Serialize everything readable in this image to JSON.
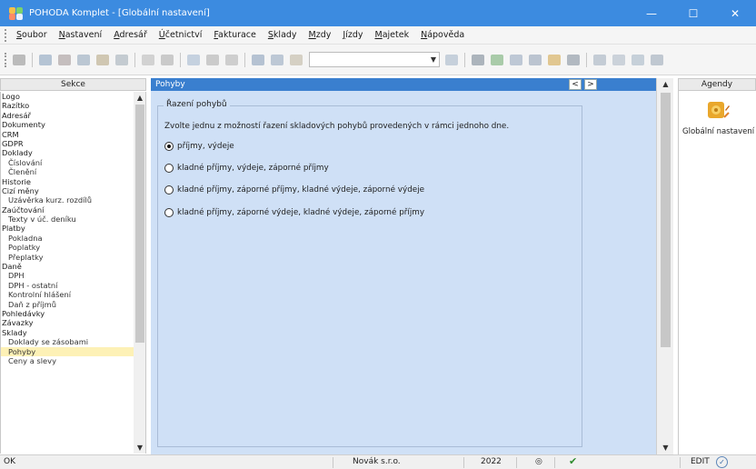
{
  "window": {
    "title": "POHODA Komplet - [Globální nastavení]",
    "minimize_glyph": "—",
    "maximize_glyph": "☐",
    "close_glyph": "✕"
  },
  "menu": {
    "items": [
      {
        "label": "Soubor",
        "key": "S",
        "rest": "oubor"
      },
      {
        "label": "Nastavení",
        "key": "N",
        "rest": "astavení"
      },
      {
        "label": "Adresář",
        "key": "A",
        "rest": "dresář"
      },
      {
        "label": "Účetnictví",
        "key": "Ú",
        "rest": "četnictví"
      },
      {
        "label": "Fakturace",
        "key": "F",
        "rest": "akturace"
      },
      {
        "label": "Sklady",
        "key": "S",
        "rest": "klady"
      },
      {
        "label": "Mzdy",
        "key": "M",
        "rest": "zdy"
      },
      {
        "label": "Jízdy",
        "key": "J",
        "rest": "ízdy"
      },
      {
        "label": "Majetek",
        "key": "M",
        "rest": "ajetek"
      },
      {
        "label": "Nápověda",
        "key": "N",
        "rest": "ápověda"
      }
    ]
  },
  "sekce": {
    "header": "Sekce",
    "items": [
      {
        "label": "Logo",
        "sub": false
      },
      {
        "label": "Razítko",
        "sub": false
      },
      {
        "label": "Adresář",
        "sub": false
      },
      {
        "label": "Dokumenty",
        "sub": false
      },
      {
        "label": "CRM",
        "sub": false
      },
      {
        "label": "GDPR",
        "sub": false
      },
      {
        "label": "Doklady",
        "sub": false
      },
      {
        "label": "Číslování",
        "sub": true
      },
      {
        "label": "Členění",
        "sub": true
      },
      {
        "label": "Historie",
        "sub": false
      },
      {
        "label": "Cizí měny",
        "sub": false
      },
      {
        "label": "Uzávěrka kurz. rozdílů",
        "sub": true
      },
      {
        "label": "Zaúčtování",
        "sub": false
      },
      {
        "label": "Texty v úč. deníku",
        "sub": true
      },
      {
        "label": "Platby",
        "sub": false
      },
      {
        "label": "Pokladna",
        "sub": true
      },
      {
        "label": "Poplatky",
        "sub": true
      },
      {
        "label": "Přeplatky",
        "sub": true
      },
      {
        "label": "Daně",
        "sub": false
      },
      {
        "label": "DPH",
        "sub": true
      },
      {
        "label": "DPH - ostatní",
        "sub": true
      },
      {
        "label": "Kontrolní hlášení",
        "sub": true
      },
      {
        "label": "Daň z příjmů",
        "sub": true
      },
      {
        "label": "Pohledávky",
        "sub": false
      },
      {
        "label": "Závazky",
        "sub": false
      },
      {
        "label": "Sklady",
        "sub": false
      },
      {
        "label": "Doklady se zásobami",
        "sub": true
      },
      {
        "label": "Pohyby",
        "sub": true,
        "selected": true
      },
      {
        "label": "Ceny a slevy",
        "sub": true
      }
    ]
  },
  "main": {
    "header": "Pohyby",
    "prev_glyph": "<",
    "next_glyph": ">",
    "group_title": "Řazení pohybů",
    "description": "Zvolte jednu z možností řazení skladových pohybů provedených v rámci jednoho dne.",
    "options": [
      {
        "label": "příjmy, výdeje",
        "checked": true
      },
      {
        "label": "kladné příjmy, výdeje, záporné příjmy",
        "checked": false
      },
      {
        "label": "kladné příjmy, záporné příjmy, kladné výdeje, záporné výdeje",
        "checked": false
      },
      {
        "label": "kladné příjmy, záporné výdeje, kladné výdeje, záporné příjmy",
        "checked": false
      }
    ]
  },
  "agendy": {
    "header": "Agendy",
    "item_label": "Globální nastavení"
  },
  "status": {
    "left": "OK",
    "company": "Novák s.r.o.",
    "year": "2022",
    "mode": "EDIT"
  },
  "colors": {
    "titlebar": "#3c8be0",
    "panel_header": "#3a7fcf",
    "content_bg": "#cfe0f6",
    "selected_item": "#fdf1b6"
  }
}
